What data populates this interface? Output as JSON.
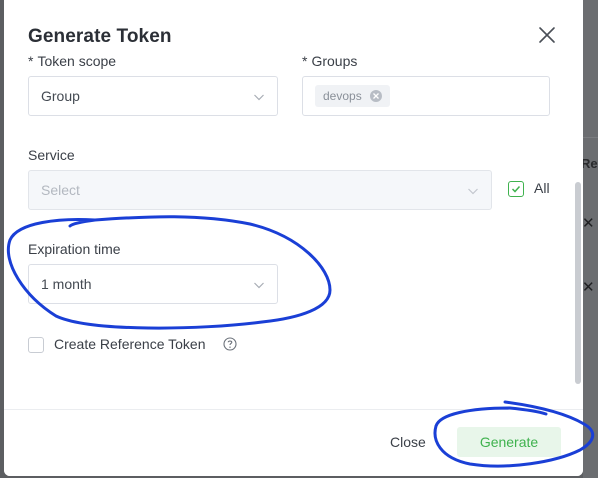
{
  "modal": {
    "title": "Generate Token",
    "close_icon": "close-icon"
  },
  "form": {
    "token_scope": {
      "label": "Token scope",
      "required_mark": "*",
      "value": "Group"
    },
    "groups": {
      "label": "Groups",
      "required_mark": "*",
      "tags": [
        "devops"
      ]
    },
    "service": {
      "label": "Service",
      "placeholder": "Select",
      "disabled": true
    },
    "all": {
      "label": "All",
      "checked": true
    },
    "expiration": {
      "label": "Expiration time",
      "value": "1 month"
    },
    "reference_token": {
      "label": "Create Reference Token",
      "checked": false,
      "help_icon": "question-circle-icon"
    }
  },
  "footer": {
    "close_label": "Close",
    "generate_label": "Generate"
  },
  "background": {
    "header_fragment": "Re"
  },
  "colors": {
    "accent": "#3fb24e",
    "annotation": "#1a3fd6"
  }
}
